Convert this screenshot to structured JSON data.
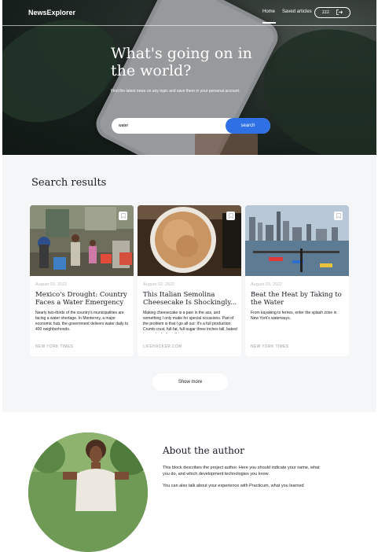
{
  "header": {
    "logo": "NewsExplorer",
    "nav": {
      "home": "Home",
      "saved": "Saved articles"
    },
    "user_button": {
      "name": "zzz",
      "icon": "logout-icon"
    }
  },
  "hero": {
    "title": "What's going on in the world?",
    "subtitle": "Find the latest news on any topic and save them in your personal account.",
    "search": {
      "value": "water",
      "button": "search"
    }
  },
  "results": {
    "title": "Search results",
    "cards": [
      {
        "date": "August 03, 2022",
        "title": "Mexico's Drought: Country Faces a Water Emergency",
        "text": "Nearly two-thirds of the country's municipalities are facing a water shortage. In Monterrey, a major economic hub, the government delivers water daily to 400 neighborhoods.",
        "source": "NEW YORK TIMES"
      },
      {
        "date": "August 02, 2022",
        "title": "This Italian Semolina Cheesecake Is Shockingly...",
        "text": "Making cheesecake is a pain in the ass, and something I only make for special occasions. Part of the problem is that I go all out: It's a full production: Crumb crust, full-fat, full-sugar three inches tall, baked in a water bath until just set...",
        "source": "LIFEHACKER.COM"
      },
      {
        "date": "August 03, 2022",
        "title": "Beat the Heat by Taking to the Water",
        "text": "From kayaking to ferries, enter the splash zone in New York's waterways.",
        "source": "NEW YORK TIMES"
      }
    ],
    "show_more": "Show more"
  },
  "about": {
    "title": "About the author",
    "p1": "This block describes the project author. Here you should indicate your name, what you do, and which development technologies you know.",
    "p2": "You can also talk about your experience with Practicum, what you learned"
  }
}
